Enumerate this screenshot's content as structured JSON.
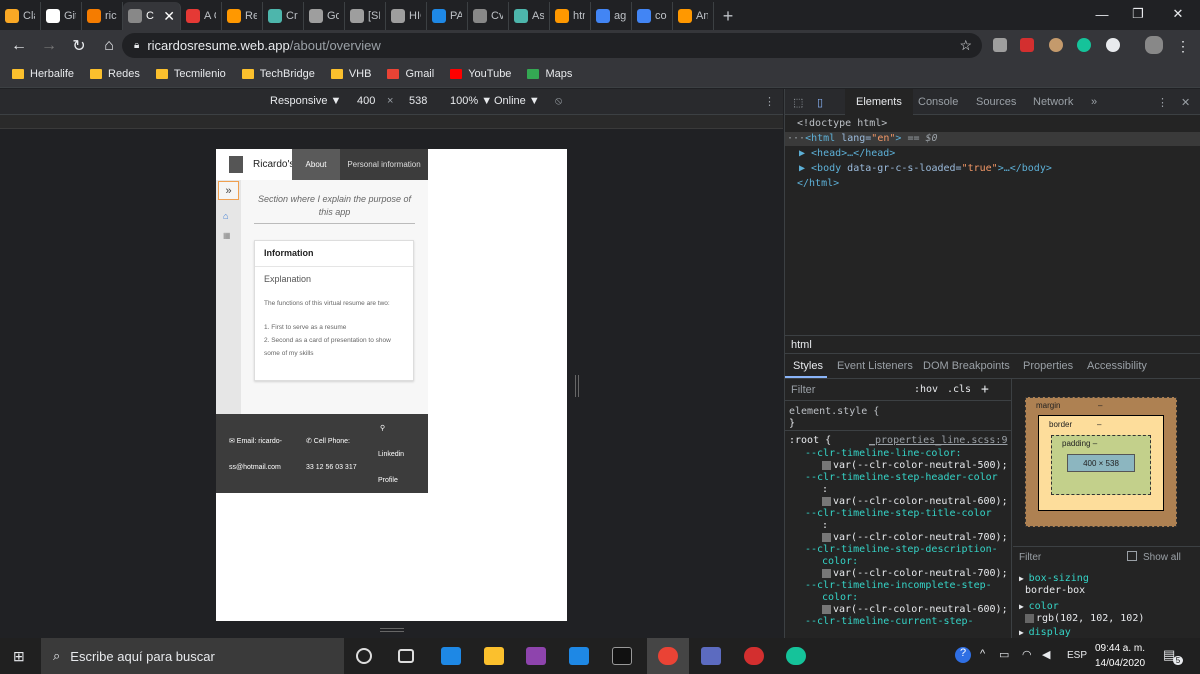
{
  "tabs": [
    {
      "label": "Clari",
      "color": "#f9a825"
    },
    {
      "label": "GitH",
      "color": "#ffffff"
    },
    {
      "label": "ricar",
      "color": "#f57c00"
    },
    {
      "label": "C",
      "color": "#888888",
      "active": true
    },
    {
      "label": "A Co",
      "color": "#e53935"
    },
    {
      "label": "Resiz",
      "color": "#ff9800"
    },
    {
      "label": "Creat",
      "color": "#4db6ac"
    },
    {
      "label": "Goo",
      "color": "#9e9e9e"
    },
    {
      "label": "[SHP",
      "color": "#9e9e9e"
    },
    {
      "label": "HICR",
      "color": "#9e9e9e"
    },
    {
      "label": "PA-S",
      "color": "#1e88e5"
    },
    {
      "label": "Cv",
      "color": "#888888"
    },
    {
      "label": "Aspe",
      "color": "#4db6ac"
    },
    {
      "label": "html",
      "color": "#ff9800"
    },
    {
      "label": "ag g",
      "color": "#4285f4"
    },
    {
      "label": "corta",
      "color": "#4285f4"
    },
    {
      "label": "Angu",
      "color": "#ff9800"
    }
  ],
  "url": {
    "host": "ricardosresume.web.app",
    "path": "/about/overview"
  },
  "bookmarks": [
    {
      "label": "Herbalife",
      "type": "folder"
    },
    {
      "label": "Redes",
      "type": "folder"
    },
    {
      "label": "Tecmilenio",
      "type": "folder"
    },
    {
      "label": "TechBridge",
      "type": "folder"
    },
    {
      "label": "VHB",
      "type": "folder"
    },
    {
      "label": "Gmail",
      "type": "gmail"
    },
    {
      "label": "YouTube",
      "type": "youtube"
    },
    {
      "label": "Maps",
      "type": "maps"
    }
  ],
  "device_toolbar": {
    "mode": "Responsive ▼",
    "width": "400",
    "x": "×",
    "height": "538",
    "zoom": "100% ▼",
    "network": "Online ▼"
  },
  "site": {
    "brand": "Ricardo's",
    "nav_about": "About",
    "nav_personal": "Personal information",
    "toggle": "»",
    "intro": "Section where I explain the purpose of this app",
    "card_title": "Information",
    "card_subtitle": "Explanation",
    "card_p1": "The functions of this virtual resume are two:",
    "card_l1": "1. First to serve as a resume",
    "card_l2": "2. Second as a card of presentation to show some of my skills",
    "footer_email_label": "✉ Email: ricardo-",
    "footer_email_value": "ss@hotmail.com",
    "footer_phone_label": "✆ Cell Phone:",
    "footer_phone_value": "33 12 56 03 317",
    "footer_link_icon": "⚲",
    "footer_linkedin_1": "Linkedin",
    "footer_linkedin_2": "Profile"
  },
  "devtools": {
    "tabs": [
      "Elements",
      "Console",
      "Sources",
      "Network",
      "»"
    ],
    "dom": {
      "doctype": "<!doctype html>",
      "html_open_prefix": "···",
      "html_tag": "<html ",
      "html_attr": "lang=",
      "html_attr_val": "\"en\"",
      "html_close": ">",
      "html_marker": "== $0",
      "head": "▶ <head>…</head>",
      "body_prefix": "▶ <body ",
      "body_attr": "data-gr-c-s-loaded=",
      "body_attr_val": "\"true\"",
      "body_suffix": ">…</body>",
      "html_end": "</html>"
    },
    "breadcrumb": "html",
    "style_tabs": [
      "Styles",
      "Event Listeners",
      "DOM Breakpoints",
      "Properties",
      "Accessibility"
    ],
    "filter_placeholder": "Filter",
    "hov": ":hov",
    "cls": ".cls",
    "plus": "+",
    "element_style": "element.style {",
    "close_brace": "}",
    "root_selector": ":root {",
    "root_source": "_properties_line.scss:9",
    "vars": [
      {
        "name": "--clr-timeline-line-color:",
        "value": "var(--clr-color-neutral-500);"
      },
      {
        "name": "--clr-timeline-step-header-color",
        "value": "var(--clr-color-neutral-600);"
      },
      {
        "name": "--clr-timeline-step-title-color",
        "value": "var(--clr-color-neutral-700);"
      },
      {
        "name": "--clr-timeline-step-description-",
        "name2": "color:",
        "value": "var(--clr-color-neutral-700);"
      },
      {
        "name": "--clr-timeline-incomplete-step-",
        "name2": "color:",
        "value": "var(--clr-color-neutral-600);"
      },
      {
        "name": "--clr-timeline-current-step-",
        "value": ""
      }
    ],
    "box": {
      "margin": "margin",
      "dash": "–",
      "border": "border",
      "padding": "padding –",
      "content": "400 × 538"
    },
    "computed_filter": "Filter",
    "show_all": "Show all",
    "computed": [
      {
        "prop": "box-sizing",
        "value": "border-box"
      },
      {
        "prop": "color",
        "value": "rgb(102, 102, 102)"
      },
      {
        "prop": "display",
        "value": ""
      }
    ]
  },
  "taskbar": {
    "search_placeholder": "Escribe aquí para buscar",
    "lang": "ESP",
    "time": "09:44 a. m.",
    "date": "14/04/2020",
    "notif": "5"
  },
  "colors": {
    "accent": "#8ab4f8",
    "tab_active": "#35363a",
    "site_nav": "#5a5a5a",
    "footer": "#3c3c3c"
  }
}
